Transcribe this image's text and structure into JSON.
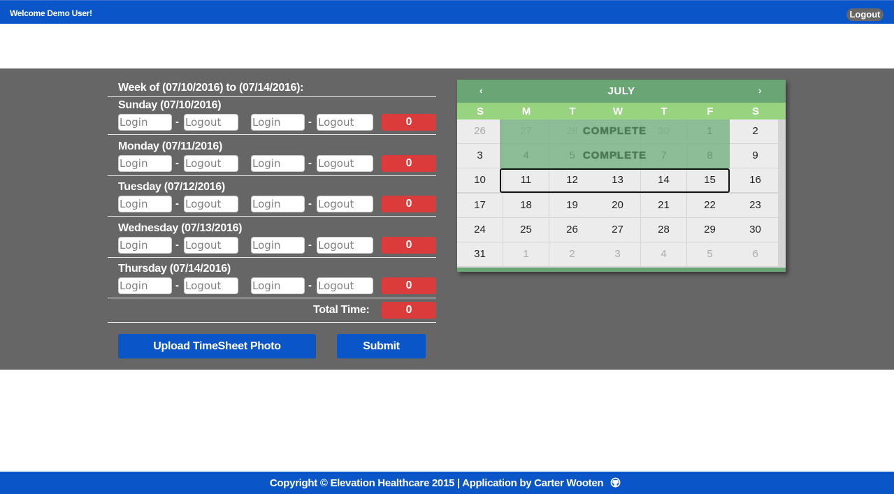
{
  "header": {
    "welcome": "Welcome Demo User!",
    "logout_label": "Logout"
  },
  "timesheet": {
    "week_title": "Week of (07/10/2016) to (07/14/2016):",
    "login_placeholder": "Login",
    "logout_placeholder": "Logout",
    "separator": "-",
    "days": [
      {
        "label": "Sunday (07/10/2016)",
        "hours": "0"
      },
      {
        "label": "Monday (07/11/2016)",
        "hours": "0"
      },
      {
        "label": "Tuesday (07/12/2016)",
        "hours": "0"
      },
      {
        "label": "Wednesday (07/13/2016)",
        "hours": "0"
      },
      {
        "label": "Thursday (07/14/2016)",
        "hours": "0"
      }
    ],
    "total_label": "Total Time:",
    "total_value": "0",
    "upload_label": "Upload TimeSheet Photo",
    "submit_label": "Submit"
  },
  "calendar": {
    "month": "JULY",
    "prev_icon": "‹",
    "next_icon": "›",
    "weekdays": [
      "S",
      "M",
      "T",
      "W",
      "T",
      "F",
      "S"
    ],
    "weeks": [
      [
        "26",
        "27",
        "28",
        "29",
        "30",
        "1",
        "2"
      ],
      [
        "3",
        "4",
        "5",
        "6",
        "7",
        "8",
        "9"
      ],
      [
        "10",
        "11",
        "12",
        "13",
        "14",
        "15",
        "16"
      ],
      [
        "17",
        "18",
        "19",
        "20",
        "21",
        "22",
        "23"
      ],
      [
        "24",
        "25",
        "26",
        "27",
        "28",
        "29",
        "30"
      ],
      [
        "31",
        "1",
        "2",
        "3",
        "4",
        "5",
        "6"
      ]
    ],
    "complete_label": "COMPLETE",
    "colors": {
      "header": "#6aa576",
      "weekday_bar": "#98d480",
      "highlight": "#78b282"
    }
  },
  "footer": {
    "text": "Copyright © Elevation Healthcare 2015 | Application by Carter Wooten",
    "github_icon": "github-icon"
  },
  "theme": {
    "primary_blue": "#0a56c8",
    "band_gray": "#666666",
    "hours_red": "#dc3b3b"
  }
}
